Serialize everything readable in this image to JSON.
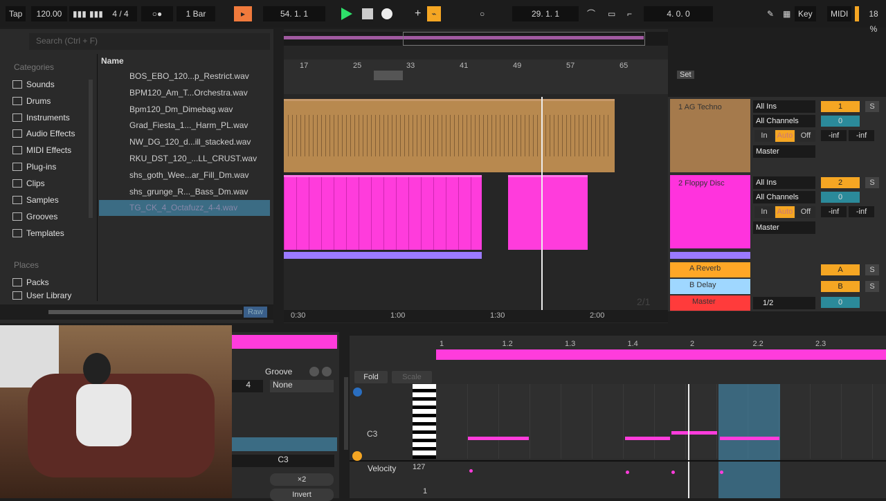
{
  "transport": {
    "tap": "Tap",
    "tempo": "120.00",
    "signature": "4 / 4",
    "metronome": "○●",
    "quantize": "1 Bar",
    "position": "54. 1. 1",
    "loop_start": "29. 1. 1",
    "loop_length": "4. 0. 0",
    "key": "Key",
    "midi": "MIDI",
    "cpu": "18 %"
  },
  "browser": {
    "search_placeholder": "Search (Ctrl + F)",
    "categories_header": "Categories",
    "categories": [
      "Sounds",
      "Drums",
      "Instruments",
      "Audio Effects",
      "MIDI Effects",
      "Plug-ins",
      "Clips",
      "Samples",
      "Grooves",
      "Templates"
    ],
    "places_header": "Places",
    "places": [
      "Packs",
      "User Library"
    ],
    "name_header": "Name",
    "files": [
      "BOS_EBO_120...p_Restrict.wav",
      "BPM120_Am_T...Orchestra.wav",
      "Bpm120_Dm_Dimebag.wav",
      "Grad_Fiesta_1..._Harm_PL.wav",
      "NW_DG_120_d...ill_stacked.wav",
      "RKU_DST_120_...LL_CRUST.wav",
      "shs_goth_Wee...ar_Fill_Dm.wav",
      "shs_grunge_R..._Bass_Dm.wav",
      "TG_CK_4_Octafuzz_4-4.wav"
    ],
    "selected": 8,
    "raw": "Raw"
  },
  "arrangement": {
    "bars": [
      "17",
      "25",
      "33",
      "41",
      "49",
      "57",
      "65"
    ],
    "times": [
      "0:30",
      "1:00",
      "1:30",
      "2:00"
    ],
    "set": "Set",
    "zoom": "2/1"
  },
  "tracks": [
    {
      "name": "1 AG Techno",
      "color": "#a57a4c",
      "input": "All Ins",
      "channel": "All Channels",
      "monitor": [
        "In",
        "Auto",
        "Off"
      ],
      "output": "Master",
      "num": "1",
      "solo": "S",
      "vol": "0",
      "meters": [
        "-inf",
        "-inf"
      ]
    },
    {
      "name": "2 Floppy Disc",
      "color": "#ff33dd",
      "input": "All Ins",
      "channel": "All Channels",
      "monitor": [
        "In",
        "Auto",
        "Off"
      ],
      "output": "Master",
      "num": "2",
      "solo": "S",
      "vol": "0",
      "meters": [
        "-inf",
        "-inf"
      ]
    }
  ],
  "returns": [
    {
      "name": "A Reverb",
      "color": "#ffa726",
      "num": "A",
      "solo": "S"
    },
    {
      "name": "B Delay",
      "color": "#9fd7ff",
      "num": "B",
      "solo": "S"
    }
  ],
  "master": {
    "name": "Master",
    "color": "#ff3b3b",
    "output": "1/2",
    "vol": "0"
  },
  "clip": {
    "groove": "Groove",
    "groove_value": "None",
    "signature_den": "4",
    "note": "C3",
    "double": "×2",
    "invert": "Invert"
  },
  "pianoroll": {
    "ruler": [
      "1",
      "1.2",
      "1.3",
      "1.4",
      "2",
      "2.2",
      "2.3"
    ],
    "fold": "Fold",
    "scale": "Scale",
    "key_label": "C3",
    "velocity": "Velocity",
    "vel_max": "127",
    "vel_min": "1"
  }
}
